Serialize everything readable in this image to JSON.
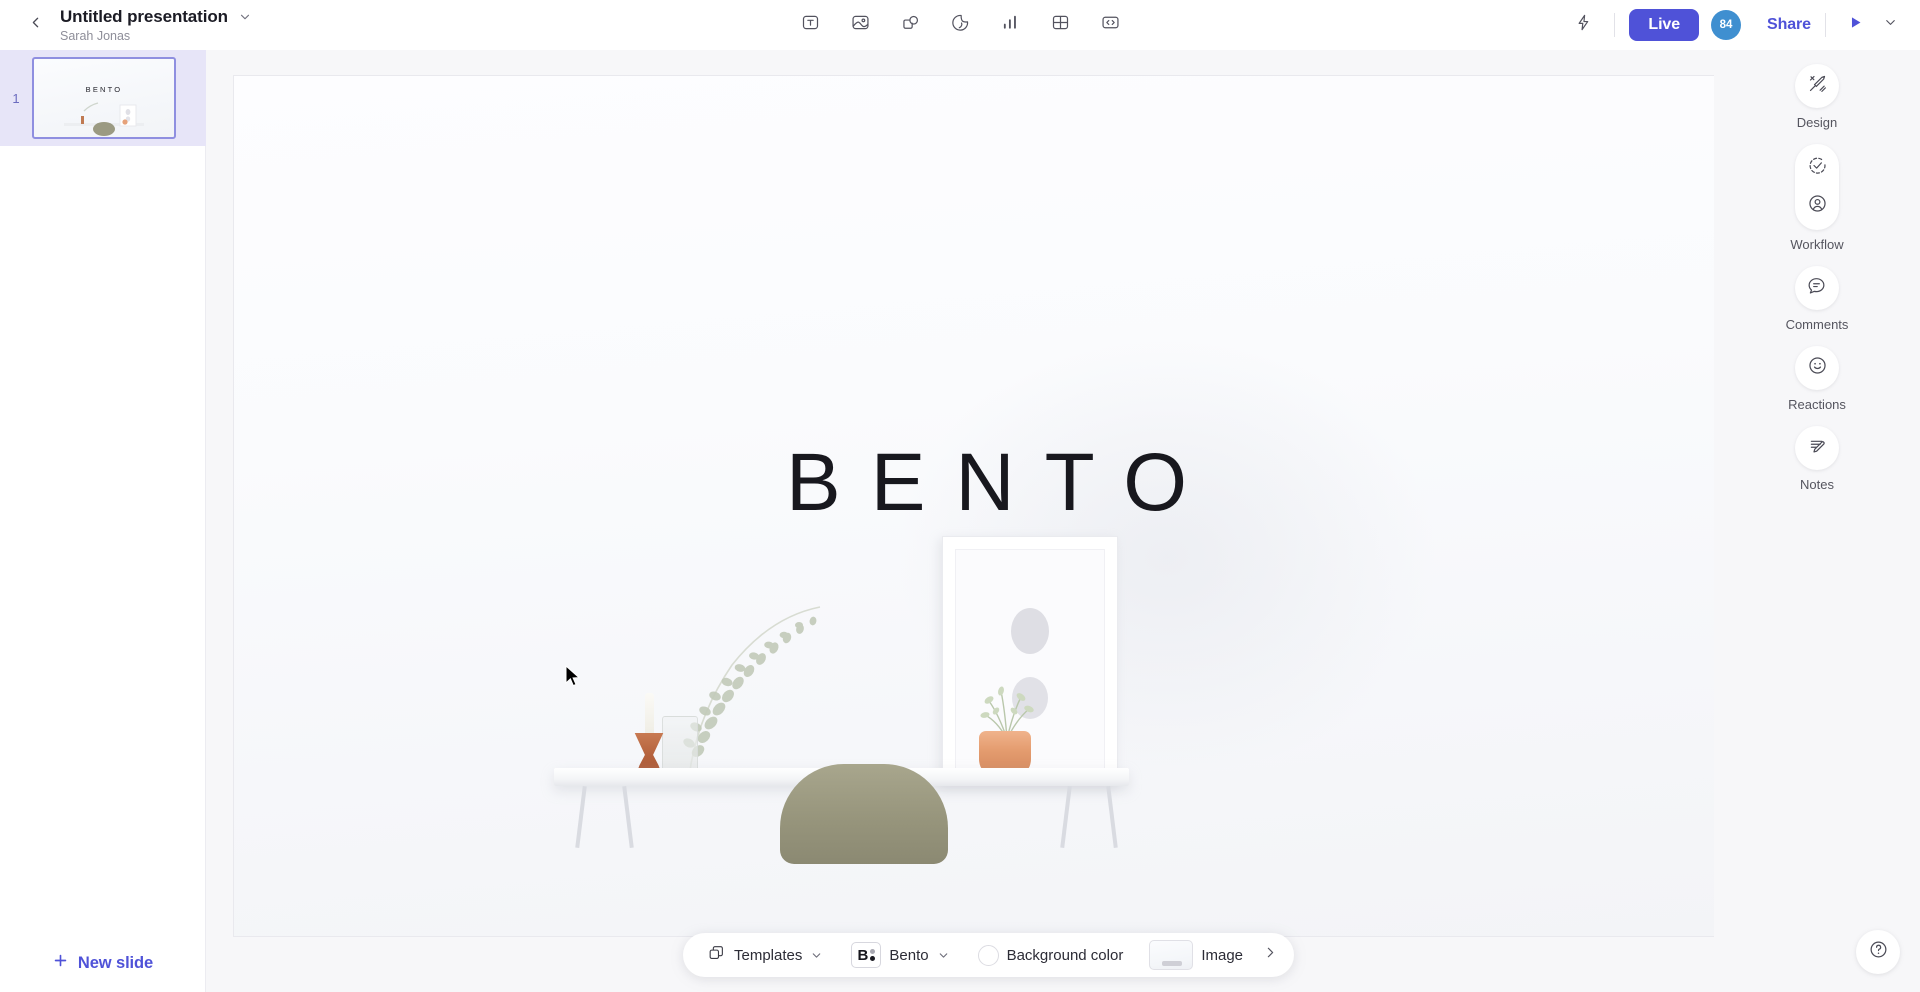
{
  "header": {
    "back_icon": "chevron-left-icon",
    "title": "Untitled presentation",
    "title_caret_icon": "chevron-down-icon",
    "author": "Sarah Jonas",
    "tools": [
      {
        "name": "text-tool",
        "icon": "text-box-icon",
        "label": "T"
      },
      {
        "name": "image-tool",
        "icon": "image-icon",
        "label": "Image"
      },
      {
        "name": "shape-tool",
        "icon": "shape-icon",
        "label": "Shape"
      },
      {
        "name": "sticker-tool",
        "icon": "sticker-icon",
        "label": "Sticker"
      },
      {
        "name": "chart-tool",
        "icon": "bar-chart-icon",
        "label": "Chart"
      },
      {
        "name": "table-tool",
        "icon": "table-grid-icon",
        "label": "Table"
      },
      {
        "name": "embed-tool",
        "icon": "code-embed-icon",
        "label": "Embed"
      }
    ],
    "bolt_icon": "lightning-bolt-icon",
    "live_label": "Live",
    "avatar_count": "84",
    "share_label": "Share",
    "present_icon": "play-triangle-icon",
    "present_caret_icon": "chevron-down-icon"
  },
  "slides_panel": {
    "slides": [
      {
        "number": "1",
        "title": "BENTO",
        "selected": true
      }
    ],
    "new_slide_label": "New slide",
    "new_slide_icon": "plus-icon"
  },
  "slide": {
    "heading": "BENTO"
  },
  "right_rail": {
    "items": [
      {
        "name": "design",
        "label": "Design",
        "icon": "design-tools-icon",
        "type": "circle"
      },
      {
        "name": "workflow",
        "label": "Workflow",
        "icons": [
          "check-circle-icon",
          "person-circle-icon"
        ],
        "type": "pill"
      },
      {
        "name": "comments",
        "label": "Comments",
        "icon": "comment-bubble-icon",
        "type": "circle"
      },
      {
        "name": "reactions",
        "label": "Reactions",
        "icon": "smiley-face-icon",
        "type": "circle"
      },
      {
        "name": "notes",
        "label": "Notes",
        "icon": "notes-pencil-icon",
        "type": "circle"
      }
    ],
    "help_icon": "question-mark-circle-icon"
  },
  "bottom_bar": {
    "templates_label": "Templates",
    "templates_icon": "layers-icon",
    "templates_caret_icon": "chevron-down-icon",
    "theme_badge": "B",
    "theme_label": "Bento",
    "theme_caret_icon": "chevron-down-icon",
    "background_color_label": "Background color",
    "background_color_value": "#ffffff",
    "image_label": "Image",
    "expand_icon": "chevron-right-icon"
  },
  "colors": {
    "accent": "#4f52d8",
    "avatar": "#3f8fd0",
    "slide_selected_bg": "#e7e5f8",
    "slide_selected_border": "#8f8fe0",
    "canvas_bg": "#f7f7f9"
  }
}
